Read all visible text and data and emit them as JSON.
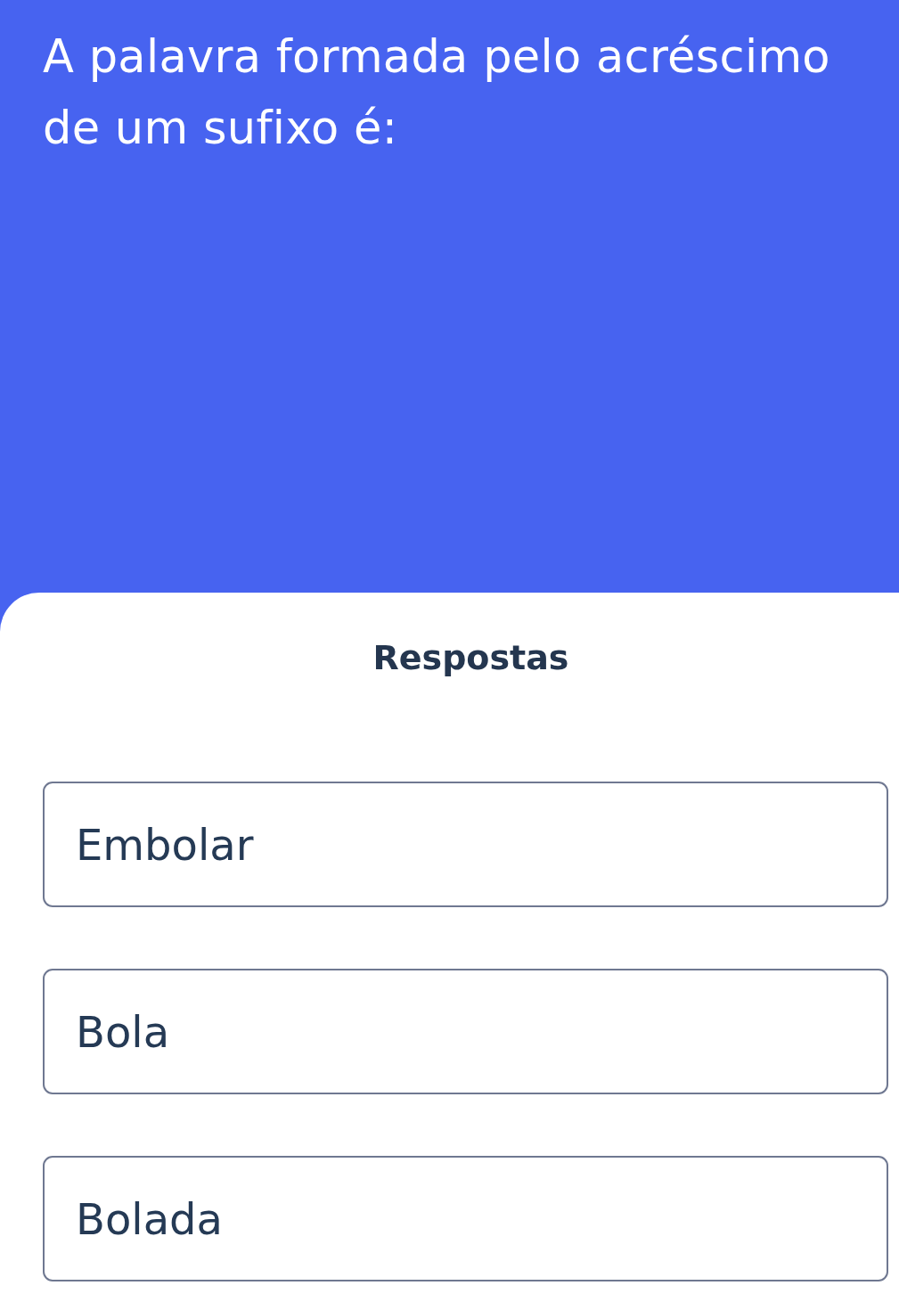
{
  "question": {
    "text": "A palavra formada pelo acréscimo de um sufixo é:"
  },
  "answers": {
    "title": "Respostas",
    "options": [
      {
        "label": "Embolar"
      },
      {
        "label": "Bola"
      },
      {
        "label": "Bolada"
      }
    ]
  }
}
